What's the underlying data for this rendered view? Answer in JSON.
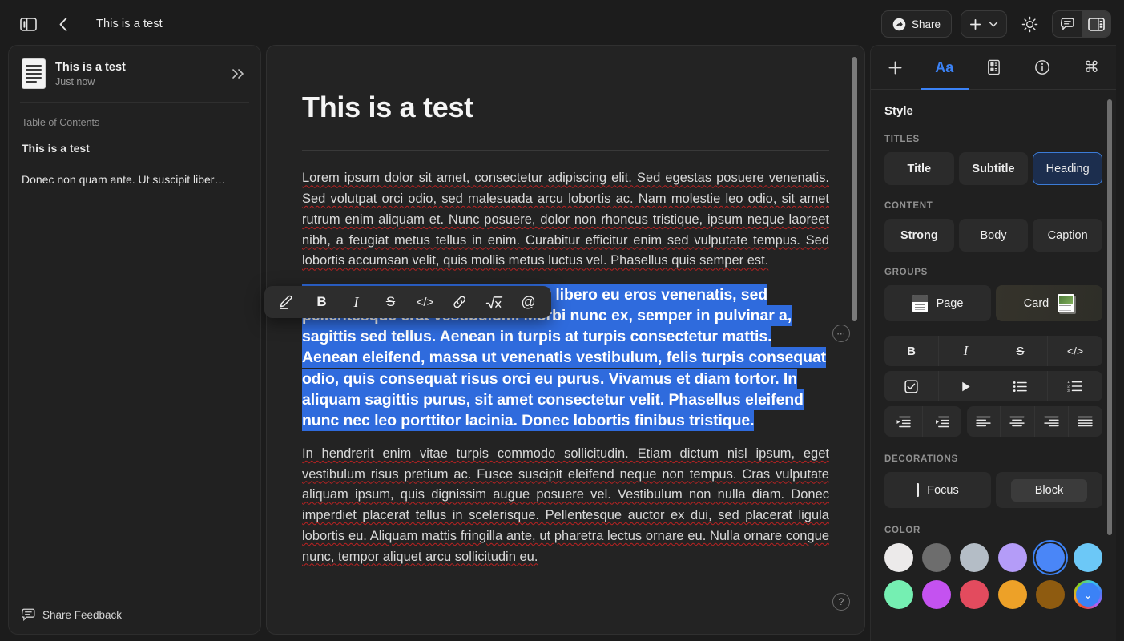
{
  "topbar": {
    "sidebar_toggle_icon": "sidebar-panel-icon",
    "back_icon": "chevron-left-icon",
    "doc_title": "This is a test",
    "share_label": "Share",
    "share_icon": "share-circle-icon",
    "plus_icon": "plus-icon",
    "plus_chevron_icon": "chevron-down-icon",
    "theme_icon": "sun-icon",
    "comment_icon": "comment-bubble-icon",
    "right_panel_icon": "right-panel-icon"
  },
  "sidebar": {
    "doc_icon": "document-lines-icon",
    "doc_title": "This is a test",
    "doc_subtitle": "Just now",
    "collapse_icon": "double-chevron-right-icon",
    "toc_label": "Table of Contents",
    "toc_items": [
      {
        "text": "This is a test",
        "bold": true
      },
      {
        "text": "Donec non quam ante. Ut suscipit liber…",
        "bold": false
      }
    ],
    "feedback_icon": "comment-bubble-icon",
    "feedback_label": "Share Feedback"
  },
  "editor": {
    "heading": "This is a test",
    "paragraph_1": "Lorem ipsum dolor sit amet, consectetur adipiscing elit. Sed egestas posuere venenatis. Sed volutpat orci odio, sed malesuada arcu lobortis ac. Nam molestie leo odio, sit amet rutrum enim aliquam et. Nunc posuere, dolor non rhoncus tristique, ipsum neque laoreet nibh, a feugiat metus tellus in enim. Curabitur efficitur enim sed vulputate tempus. Sed lobortis accumsan velit, quis mollis metus luctus vel. Phasellus quis semper est.",
    "paragraph_2_selected": "Donec non quam ante. Ut suscipit libero eu eros venenatis, sed pellentesque erat vestibulum. Morbi nunc ex, semper in pulvinar a, sagittis sed tellus. Aenean in turpis at turpis consectetur mattis. Aenean eleifend, massa ut venenatis vestibulum, felis turpis consequat odio, quis consequat risus orci eu purus. Vivamus et diam tortor. In aliquam sagittis purus, sit amet consectetur velit. Phasellus eleifend nunc nec leo porttitor lacinia. Donec lobortis finibus tristique.",
    "paragraph_3": "In hendrerit enim vitae turpis commodo sollicitudin. Etiam dictum nisl ipsum, eget vestibulum risus pretium ac. Fusce suscipit eleifend neque non tempus. Cras vulputate aliquam ipsum, quis dignissim augue posuere vel. Vestibulum non nulla diam. Donec imperdiet placerat tellus in scelerisque. Pellentesque auctor ex dui, sed placerat ligula lobortis eu. Aliquam mattis fringilla ante, ut pharetra lectus ornare eu. Nulla ornare congue nunc, tempor aliquet arcu sollicitudin eu.",
    "block_menu_label": "⋯",
    "help_label": "?",
    "selection_color": "#2f6bdd"
  },
  "format_toolbar": {
    "items": [
      {
        "name": "highlight-pen-icon",
        "glyph": "✎"
      },
      {
        "name": "bold-button",
        "glyph": "B"
      },
      {
        "name": "italic-button",
        "glyph": "I"
      },
      {
        "name": "strikethrough-button",
        "glyph": "S"
      },
      {
        "name": "code-button",
        "glyph": "</>"
      },
      {
        "name": "link-button",
        "glyph": "🔗"
      },
      {
        "name": "formula-button",
        "glyph": "√x"
      },
      {
        "name": "mention-button",
        "glyph": "@"
      }
    ]
  },
  "right_panel": {
    "tabs": [
      {
        "name": "tab-insert",
        "icon": "plus-icon",
        "label": "+",
        "active": false
      },
      {
        "name": "tab-style",
        "icon": "text-format-icon",
        "label": "Aa",
        "active": true
      },
      {
        "name": "tab-media",
        "icon": "media-card-icon",
        "label": "",
        "active": false
      },
      {
        "name": "tab-info",
        "icon": "info-circle-icon",
        "label": "",
        "active": false
      },
      {
        "name": "tab-shortcuts",
        "icon": "command-key-icon",
        "label": "⌘",
        "active": false
      }
    ],
    "heading": "Style",
    "titles_label": "TITLES",
    "titles": [
      {
        "label": "Title",
        "selected": false
      },
      {
        "label": "Subtitle",
        "selected": false
      },
      {
        "label": "Heading",
        "selected": true
      }
    ],
    "content_label": "CONTENT",
    "content": [
      {
        "label": "Strong",
        "selected": false
      },
      {
        "label": "Body",
        "selected": false
      },
      {
        "label": "Caption",
        "selected": false
      }
    ],
    "groups_label": "GROUPS",
    "groups": [
      {
        "label": "Page",
        "icon": "page-icon",
        "selected": false
      },
      {
        "label": "Card",
        "icon": "card-icon",
        "selected": true
      }
    ],
    "inline_format": [
      {
        "name": "bold-button",
        "glyph": "B"
      },
      {
        "name": "italic-button",
        "glyph": "I"
      },
      {
        "name": "strikethrough-button",
        "glyph": "S"
      },
      {
        "name": "code-button",
        "glyph": "</>"
      }
    ],
    "list_format": [
      {
        "name": "checklist-button",
        "glyph": "☑"
      },
      {
        "name": "toggle-list-button",
        "glyph": "▶"
      },
      {
        "name": "bullet-list-button",
        "glyph": "•≡"
      },
      {
        "name": "numbered-list-button",
        "glyph": "1≡"
      }
    ],
    "indent": [
      {
        "name": "outdent-button",
        "glyph": "⇤"
      },
      {
        "name": "indent-button",
        "glyph": "⇥"
      }
    ],
    "align": [
      {
        "name": "align-left-button",
        "glyph": "≡"
      },
      {
        "name": "align-center-button",
        "glyph": "≡"
      },
      {
        "name": "align-right-button",
        "glyph": "≡"
      },
      {
        "name": "align-justify-button",
        "glyph": "≡"
      }
    ],
    "decorations_label": "DECORATIONS",
    "decorations": [
      {
        "label": "Focus",
        "selected": false
      },
      {
        "label": "Block",
        "selected": true
      }
    ],
    "color_label": "COLOR",
    "colors": [
      {
        "name": "color-white",
        "hex": "#eceaea",
        "selected": false
      },
      {
        "name": "color-gray",
        "hex": "#6d6d6d",
        "selected": false
      },
      {
        "name": "color-silver",
        "hex": "#b4bdc6",
        "selected": false
      },
      {
        "name": "color-lavender",
        "hex": "#b49cf8",
        "selected": false
      },
      {
        "name": "color-blue",
        "hex": "#4a86f7",
        "selected": true
      },
      {
        "name": "color-sky",
        "hex": "#6cc8f7",
        "selected": false
      },
      {
        "name": "color-mint",
        "hex": "#75efb2",
        "selected": false
      },
      {
        "name": "color-magenta",
        "hex": "#c452f0",
        "selected": false
      },
      {
        "name": "color-red",
        "hex": "#e34b5e",
        "selected": false
      },
      {
        "name": "color-orange",
        "hex": "#eda128",
        "selected": false
      },
      {
        "name": "color-brown",
        "hex": "#8e5b10",
        "selected": false
      },
      {
        "name": "color-more",
        "hex": "rainbow",
        "selected": false
      }
    ]
  }
}
